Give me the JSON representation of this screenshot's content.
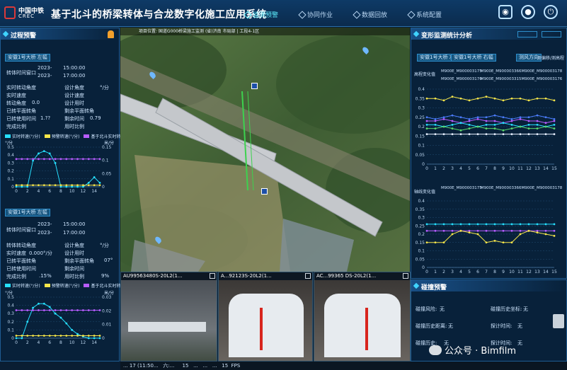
{
  "header": {
    "logo_cn": "中国中铁",
    "logo_en": "CREC",
    "title": "基于北斗的桥梁转体与合龙数字化施工应用系统",
    "nav": [
      {
        "label": "监测预警",
        "active": true
      },
      {
        "label": "协同作业",
        "active": false
      },
      {
        "label": "数据回放",
        "active": false
      },
      {
        "label": "系统配置",
        "active": false
      }
    ]
  },
  "left_panel": {
    "title": "过程预警",
    "blocks": [
      {
        "tag": "安徽1号大桥 左幅",
        "time_label": "转体时间窗口",
        "time_start_date": "2023-",
        "time_start": "15:00:00",
        "time_end_date": "2023-",
        "time_end": "17:00:00",
        "rows": [
          {
            "k": "实时转动角度",
            "v": "",
            "k2": "设计角度",
            "v2": "°/分"
          },
          {
            "k": "实时速度",
            "v": "",
            "k2": "设计速度",
            "v2": ""
          },
          {
            "k": "转动角度",
            "v": "0.0",
            "k2": "设计用时",
            "v2": ""
          },
          {
            "k": "已转平面转角",
            "v": "",
            "k2": "剩余平面转角",
            "v2": ""
          },
          {
            "k": "已转使用时间",
            "v": "1.??",
            "k2": "剩余时间",
            "v2": "0.79"
          },
          {
            "k": "完成比例",
            "v": "",
            "k2": "用时比例",
            "v2": ""
          }
        ],
        "legend": [
          "实时转速(°/分)",
          "预警转速(°/分)",
          "基于北斗实时转速(米/分)"
        ],
        "y_left_unit": "°/分",
        "y_right_unit": "米/分"
      },
      {
        "tag": "安徽1号大桥 左幅",
        "time_label": "转体时间窗口",
        "time_start_date": "2023-",
        "time_start": "15:00:00",
        "time_end_date": "2023-",
        "time_end": "17:00:00",
        "rows": [
          {
            "k": "转体转动角度",
            "v": "",
            "k2": "设计角度",
            "v2": "°/分"
          },
          {
            "k": "实时速度",
            "v": "0.000°/分",
            "k2": "设计用时",
            "v2": ""
          },
          {
            "k": "已转平面转角",
            "v": "",
            "k2": "剩余平面转角",
            "v2": "07°"
          },
          {
            "k": "已转使用时间",
            "v": "",
            "k2": "剩余时间",
            "v2": ""
          },
          {
            "k": "完成比例",
            "v": ".15%",
            "k2": "用时比例",
            "v2": "9%"
          }
        ],
        "legend": [
          "实时转速(°/分)",
          "预警转速(°/分)",
          "基于北斗实时转速(米/分)"
        ],
        "y_left_unit": "°/分",
        "y_right_unit": "米/分"
      }
    ]
  },
  "map": {
    "location_bar": "项目位置: 国道G000桥梁施工监测 (省)济南 市局部 | 工段4-1区"
  },
  "videos": [
    {
      "title": "AU99563480S-20L2(1..."
    },
    {
      "title": "A...92123S-20L2(1..."
    },
    {
      "title": "AC...99365 DS-20L2(1..."
    }
  ],
  "status_bar": {
    "items": [
      "... 17 (11:50...",
      "六:...",
      "15",
      "...",
      "...",
      "...",
      "15",
      "FPS"
    ]
  },
  "right_panel": {
    "title": "变形监测统计分析",
    "buttons": [
      "安徽1号大桥 左幅",
      "安徽1号大桥 右幅",
      "测风方向",
      "测偏移/测高程"
    ],
    "chart1_label": "高程变化值",
    "chart2_label": "轴线变化值",
    "sensor_legend": [
      "M900E_M900003175",
      "M900E_M900003366",
      "M900E_M900003178",
      "M900E_M900003176",
      "M900E_M900003315",
      "M900E_M900003176"
    ],
    "warning_title": "碰撞预警",
    "warning_rows": [
      {
        "k": "碰撞风险:",
        "v": "无",
        "k2": "碰撞历史坐标:",
        "v2": "无"
      },
      {
        "k": "碰撞历史距离:",
        "v": "无",
        "k2": "探计时间:",
        "v2": "无"
      },
      {
        "k": "碰撞历史:",
        "v": "无",
        "k2": "探计时间:",
        "v2": "无"
      }
    ]
  },
  "watermark": {
    "text": "公众号 · Bimfilm"
  },
  "colors": {
    "accent": "#3fd4ff",
    "panel_bg": "#08223a",
    "series_cyan": "#26e0ff",
    "series_yellow": "#f6e64a",
    "series_purple": "#b65cff",
    "series_green": "#5bd66d",
    "series_blue": "#4c7dff"
  },
  "chart_data": [
    {
      "type": "line",
      "title": "",
      "x": [
        0,
        1,
        2,
        3,
        4,
        5,
        6,
        7,
        8,
        9,
        10,
        11,
        12,
        13,
        14,
        15
      ],
      "xticks": [
        0,
        2,
        4,
        6,
        8,
        10,
        12,
        14
      ],
      "ylim": [
        0,
        0.5
      ],
      "y2lim": [
        0,
        0.15
      ],
      "series": [
        {
          "name": "实时转速(°/分)",
          "color": "#26e0ff",
          "values": [
            0,
            0,
            0,
            0.33,
            0.42,
            0.45,
            0.42,
            0.3,
            0,
            0,
            0,
            0,
            0,
            0.05,
            0.12,
            0.05
          ]
        },
        {
          "name": "预警转速(°/分)",
          "color": "#f6e64a",
          "values": [
            0.02,
            0.02,
            0.02,
            0.02,
            0.02,
            0.02,
            0.02,
            0.02,
            0.02,
            0.02,
            0.02,
            0.02,
            0.02,
            0.02,
            0.02,
            0.02
          ]
        },
        {
          "name": "基于北斗实时转速(米/分)",
          "color": "#b65cff",
          "values": [
            0.35,
            0.35,
            0.35,
            0.35,
            0.35,
            0.35,
            0.35,
            0.35,
            0.35,
            0.35,
            0.35,
            0.35,
            0.35,
            0.35,
            0.35,
            0.35
          ]
        }
      ]
    },
    {
      "type": "line",
      "title": "",
      "x": [
        0,
        1,
        2,
        3,
        4,
        5,
        6,
        7,
        8,
        9,
        10,
        11,
        12,
        13,
        14,
        15
      ],
      "xticks": [
        0,
        2,
        4,
        6,
        8,
        10,
        12,
        14
      ],
      "ylim": [
        0,
        0.5
      ],
      "y2lim": [
        0,
        0.03
      ],
      "series": [
        {
          "name": "实时转速(°/分)",
          "color": "#26e0ff",
          "values": [
            0,
            0,
            0.2,
            0.37,
            0.42,
            0.42,
            0.38,
            0.3,
            0.25,
            0.18,
            0.1,
            0.05,
            0.02,
            0,
            0,
            0
          ]
        },
        {
          "name": "预警转速(°/分)",
          "color": "#f6e64a",
          "values": [
            0.03,
            0.03,
            0.03,
            0.03,
            0.03,
            0.03,
            0.03,
            0.03,
            0.03,
            0.03,
            0.03,
            0.03,
            0.03,
            0.03,
            0.03,
            0.03
          ]
        },
        {
          "name": "基于北斗实时转速(米/分)",
          "color": "#b65cff",
          "values": [
            0.34,
            0.34,
            0.34,
            0.34,
            0.34,
            0.34,
            0.34,
            0.34,
            0.34,
            0.34,
            0.34,
            0.34,
            0.34,
            0.34,
            0.34,
            0.34
          ]
        }
      ]
    },
    {
      "type": "line",
      "title": "",
      "x": [
        0,
        1,
        2,
        3,
        4,
        5,
        6,
        7,
        8,
        9,
        10,
        11,
        12,
        13,
        14,
        15
      ],
      "xticks": [
        0,
        1,
        2,
        3,
        4,
        5,
        6,
        7,
        8,
        9,
        10,
        11,
        12,
        13,
        14,
        15
      ],
      "ylim": [
        0,
        0.4
      ],
      "ytick_labels": [
        "0",
        "0.05",
        "0.1",
        "0.15",
        "0.2",
        "0.25",
        "0.3",
        "0.35",
        "0.4"
      ],
      "series": [
        {
          "name": "M900E_M900003175",
          "color": "#f6e64a",
          "values": [
            0.35,
            0.35,
            0.34,
            0.36,
            0.35,
            0.34,
            0.35,
            0.36,
            0.35,
            0.34,
            0.35,
            0.35,
            0.34,
            0.35,
            0.35,
            0.34
          ]
        },
        {
          "name": "M900E_M900003366",
          "color": "#4c7dff",
          "values": [
            0.25,
            0.24,
            0.25,
            0.26,
            0.25,
            0.24,
            0.25,
            0.25,
            0.26,
            0.25,
            0.24,
            0.25,
            0.25,
            0.26,
            0.25,
            0.24
          ]
        },
        {
          "name": "M900E_M900003178",
          "color": "#b65cff",
          "values": [
            0.23,
            0.23,
            0.24,
            0.23,
            0.22,
            0.23,
            0.24,
            0.23,
            0.23,
            0.22,
            0.23,
            0.24,
            0.23,
            0.23,
            0.22,
            0.23
          ]
        },
        {
          "name": "M900E_M900003176",
          "color": "#26e0ff",
          "values": [
            0.21,
            0.21,
            0.2,
            0.21,
            0.22,
            0.21,
            0.2,
            0.21,
            0.21,
            0.22,
            0.21,
            0.2,
            0.21,
            0.21,
            0.2,
            0.21
          ]
        },
        {
          "name": "M900E_M900003315",
          "color": "#5bd66d",
          "values": [
            0.19,
            0.19,
            0.2,
            0.19,
            0.18,
            0.19,
            0.2,
            0.19,
            0.19,
            0.18,
            0.19,
            0.2,
            0.19,
            0.19,
            0.2,
            0.19
          ]
        },
        {
          "name": "M900E_M900003176",
          "color": "#e7f0ff",
          "values": [
            0.16,
            0.16,
            0.16,
            0.16,
            0.16,
            0.16,
            0.16,
            0.16,
            0.16,
            0.16,
            0.16,
            0.16,
            0.16,
            0.16,
            0.16,
            0.16
          ]
        }
      ]
    },
    {
      "type": "line",
      "title": "",
      "x": [
        0,
        1,
        2,
        3,
        4,
        5,
        6,
        7,
        8,
        9,
        10,
        11,
        12,
        13,
        14,
        15
      ],
      "xticks": [
        0,
        1,
        2,
        3,
        4,
        5,
        6,
        7,
        8,
        9,
        10,
        11,
        12,
        13,
        14,
        15
      ],
      "ylim": [
        0,
        0.4
      ],
      "ytick_labels": [
        "0",
        "0.05",
        "0.1",
        "0.15",
        "0.2",
        "0.25",
        "0.3",
        "0.35",
        "0.4"
      ],
      "series": [
        {
          "name": "M900E_M900003175",
          "color": "#26e0ff",
          "values": [
            0.26,
            0.26,
            0.26,
            0.26,
            0.26,
            0.26,
            0.26,
            0.26,
            0.26,
            0.26,
            0.26,
            0.26,
            0.26,
            0.26,
            0.26,
            0.26
          ]
        },
        {
          "name": "M900E_M900003366",
          "color": "#b65cff",
          "values": [
            0.22,
            0.22,
            0.22,
            0.22,
            0.22,
            0.22,
            0.22,
            0.22,
            0.22,
            0.22,
            0.22,
            0.22,
            0.22,
            0.22,
            0.22,
            0.22
          ]
        },
        {
          "name": "M900E_M900003178",
          "color": "#f6e64a",
          "values": [
            0.15,
            0.15,
            0.15,
            0.2,
            0.22,
            0.21,
            0.2,
            0.15,
            0.16,
            0.15,
            0.15,
            0.2,
            0.22,
            0.21,
            0.2,
            0.19
          ]
        }
      ]
    }
  ]
}
